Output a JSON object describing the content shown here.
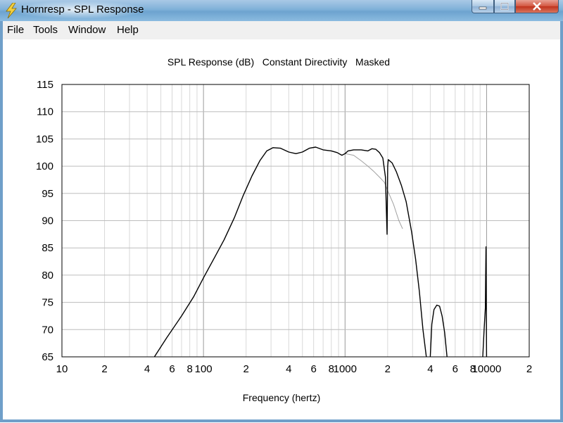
{
  "window": {
    "title": "Hornresp - SPL Response"
  },
  "menu": {
    "items": [
      "File",
      "Tools",
      "Window",
      "Help"
    ]
  },
  "chart_data": {
    "type": "line",
    "title": "SPL Response (dB)   Constant Directivity   Masked",
    "xlabel": "Frequency (hertz)",
    "ylabel": "",
    "x_scale": "log",
    "xlim": [
      10,
      20000
    ],
    "ylim": [
      65,
      115
    ],
    "y_ticks": [
      115,
      110,
      105,
      100,
      95,
      90,
      85,
      80,
      75,
      70,
      65
    ],
    "x_tick_labels": [
      {
        "f": 10,
        "label": "10"
      },
      {
        "f": 20,
        "label": "2"
      },
      {
        "f": 40,
        "label": "4"
      },
      {
        "f": 60,
        "label": "6"
      },
      {
        "f": 80,
        "label": "8"
      },
      {
        "f": 100,
        "label": "100"
      },
      {
        "f": 200,
        "label": "2"
      },
      {
        "f": 400,
        "label": "4"
      },
      {
        "f": 600,
        "label": "6"
      },
      {
        "f": 800,
        "label": "8"
      },
      {
        "f": 1000,
        "label": "1000"
      },
      {
        "f": 2000,
        "label": "2"
      },
      {
        "f": 4000,
        "label": "4"
      },
      {
        "f": 6000,
        "label": "6"
      },
      {
        "f": 8000,
        "label": "8"
      },
      {
        "f": 10000,
        "label": "10000"
      },
      {
        "f": 20000,
        "label": "2"
      }
    ],
    "grid": true,
    "series": [
      {
        "color": "#000000",
        "points": [
          [
            45,
            65
          ],
          [
            55,
            68.5
          ],
          [
            70,
            72.5
          ],
          [
            85,
            76
          ],
          [
            100,
            79.5
          ],
          [
            120,
            83.3
          ],
          [
            140,
            86.5
          ],
          [
            165,
            90.5
          ],
          [
            190,
            94.5
          ],
          [
            220,
            98.2
          ],
          [
            250,
            101
          ],
          [
            280,
            102.8
          ],
          [
            310,
            103.4
          ],
          [
            350,
            103.3
          ],
          [
            400,
            102.6
          ],
          [
            450,
            102.3
          ],
          [
            500,
            102.6
          ],
          [
            560,
            103.3
          ],
          [
            620,
            103.5
          ],
          [
            700,
            103
          ],
          [
            800,
            102.8
          ],
          [
            880,
            102.5
          ],
          [
            950,
            102
          ],
          [
            1000,
            102.3
          ],
          [
            1050,
            102.8
          ],
          [
            1150,
            103
          ],
          [
            1300,
            103
          ],
          [
            1450,
            102.8
          ],
          [
            1550,
            103.2
          ],
          [
            1650,
            103.1
          ],
          [
            1750,
            102.5
          ],
          [
            1850,
            101.5
          ],
          [
            1930,
            98
          ],
          [
            1980,
            87.5
          ],
          [
            2000,
            100
          ],
          [
            2020,
            101.2
          ],
          [
            2150,
            100.6
          ],
          [
            2300,
            99
          ],
          [
            2500,
            96.5
          ],
          [
            2700,
            93.5
          ],
          [
            2950,
            88
          ],
          [
            3150,
            83
          ],
          [
            3350,
            77
          ],
          [
            3550,
            70
          ],
          [
            3750,
            65
          ]
        ]
      },
      {
        "color": "#000000",
        "points": [
          [
            4000,
            65
          ],
          [
            4100,
            71
          ],
          [
            4250,
            73.7
          ],
          [
            4450,
            74.5
          ],
          [
            4650,
            74.3
          ],
          [
            4850,
            72.5
          ],
          [
            5050,
            69.5
          ],
          [
            5250,
            65
          ]
        ]
      },
      {
        "color": "#000000",
        "points": [
          [
            9400,
            65
          ],
          [
            9600,
            70
          ],
          [
            9800,
            74
          ],
          [
            9850,
            79.5
          ],
          [
            9900,
            85.2
          ],
          [
            9950,
            75
          ],
          [
            10000,
            65
          ]
        ]
      },
      {
        "color": "#a0a0a0",
        "points": [
          [
            1000,
            102.3
          ],
          [
            1150,
            102
          ],
          [
            1300,
            101
          ],
          [
            1450,
            100
          ],
          [
            1600,
            99
          ],
          [
            1750,
            98
          ],
          [
            1900,
            97
          ],
          [
            2000,
            95.5
          ],
          [
            2200,
            93
          ],
          [
            2400,
            90
          ],
          [
            2550,
            88.5
          ]
        ]
      }
    ]
  }
}
